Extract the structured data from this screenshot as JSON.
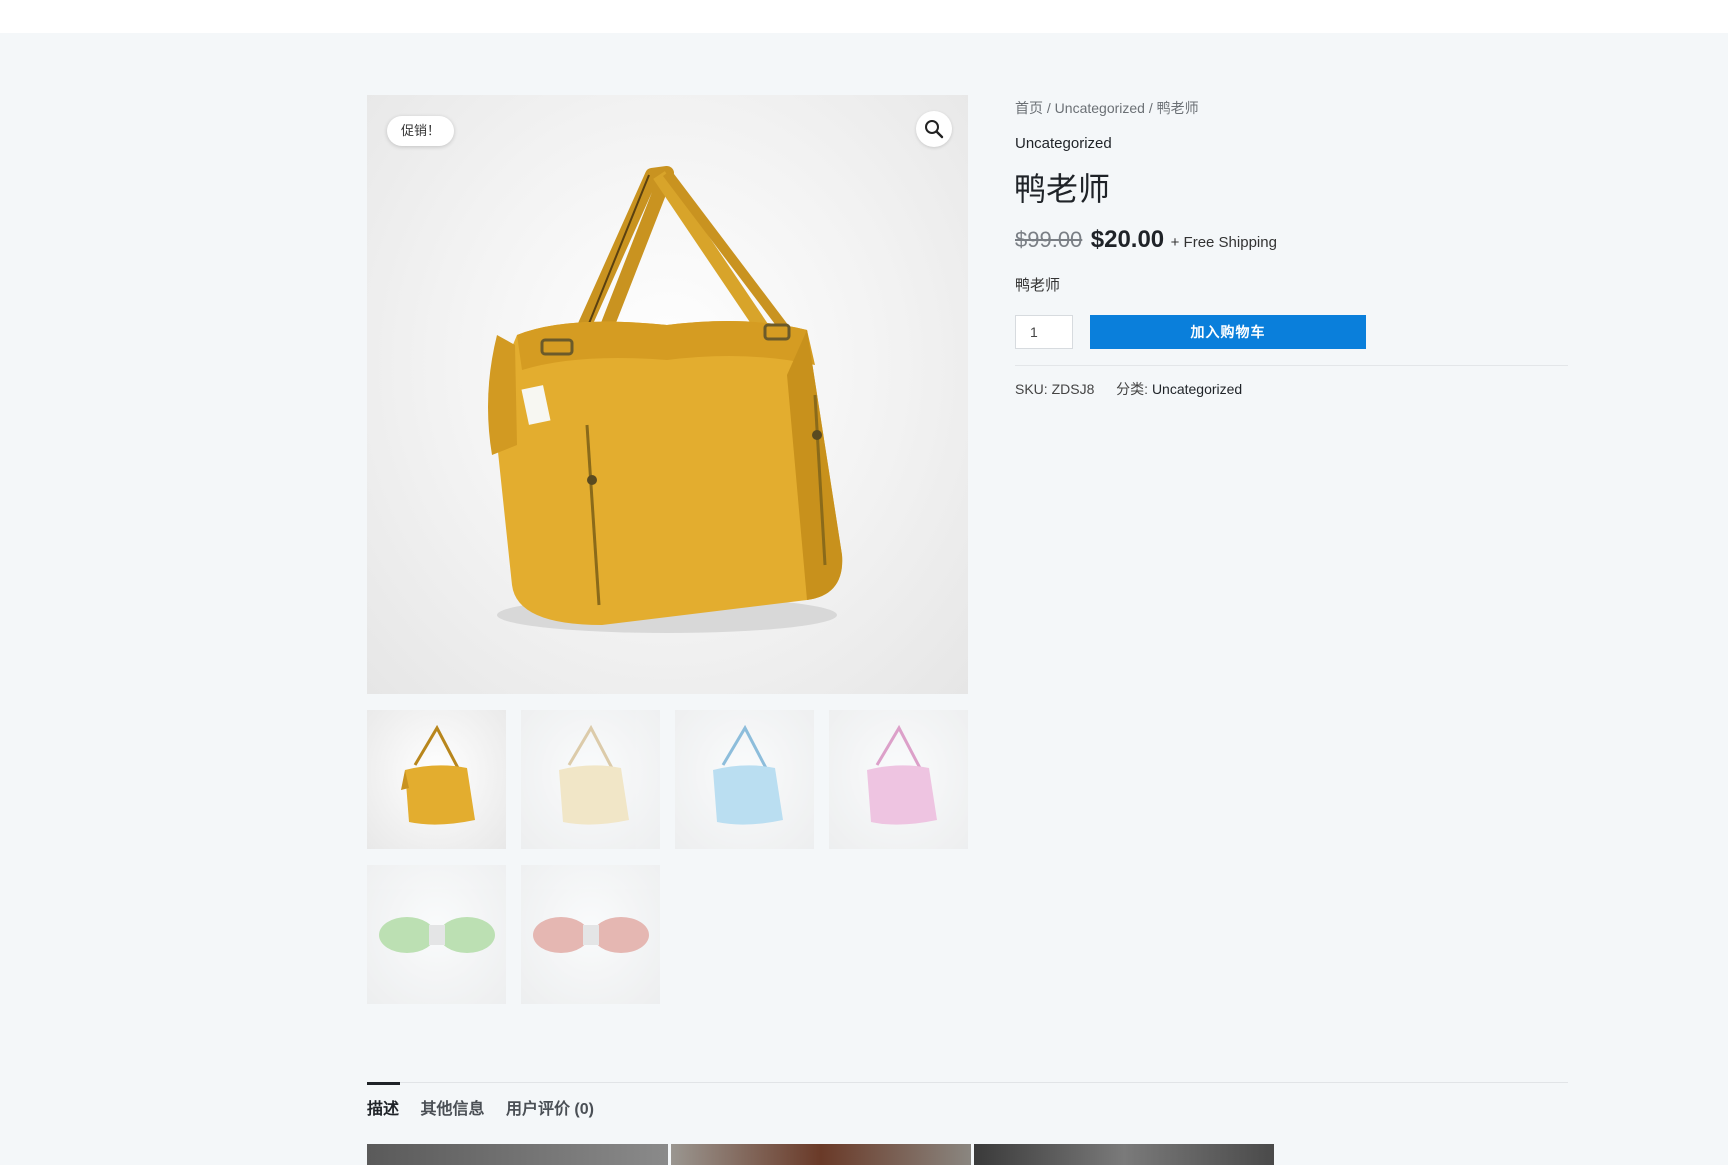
{
  "colors": {
    "accent": "#0a7fdb",
    "bag_yellow": "#e3ad2f",
    "bag_beige": "#efd9a0",
    "bag_blue": "#8ccbec",
    "bag_pink": "#ea9ccf",
    "bracelet_green": "#8fcf7a",
    "bracelet_red": "#d98379"
  },
  "gallery": {
    "sale_badge": "促销！",
    "zoom_icon": "magnifier-icon",
    "thumbnails": [
      {
        "color": "yellow"
      },
      {
        "color": "beige"
      },
      {
        "color": "blue"
      },
      {
        "color": "pink"
      },
      {
        "color": "green"
      },
      {
        "color": "red"
      }
    ]
  },
  "breadcrumb": {
    "home": "首页",
    "sep": " / ",
    "category": "Uncategorized",
    "current": "鸭老师"
  },
  "product": {
    "category": "Uncategorized",
    "title": "鸭老师",
    "old_price": "$99.00",
    "new_price": "$20.00",
    "shipping": "+ Free Shipping",
    "short_description": "鸭老师",
    "quantity": "1",
    "add_to_cart": "加入购物车",
    "sku_label": "SKU:",
    "sku": "ZDSJ8",
    "category_label": "分类:",
    "category_value": "Uncategorized"
  },
  "tabs": [
    {
      "label": "描述",
      "active": true
    },
    {
      "label": "其他信息",
      "active": false
    },
    {
      "label": "用户评价 (0)",
      "active": false
    }
  ]
}
